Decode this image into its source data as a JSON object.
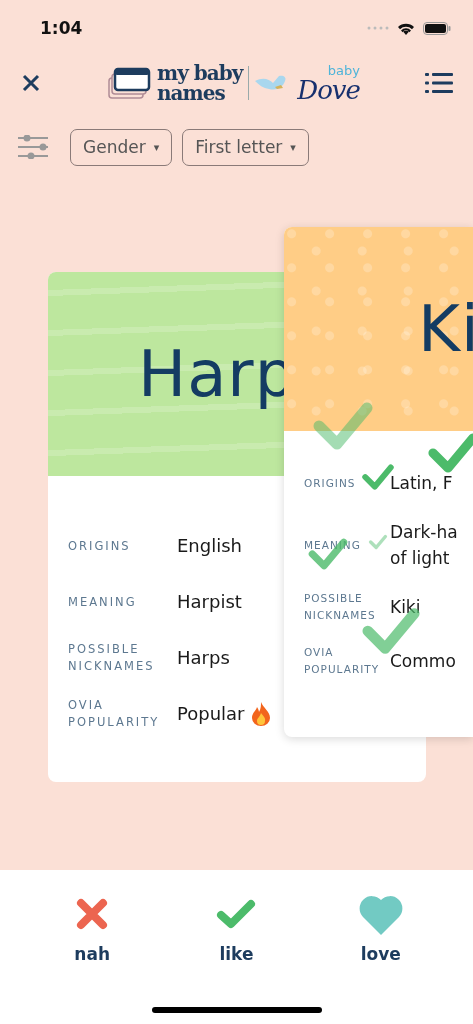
{
  "status_bar": {
    "time": "1:04"
  },
  "logo": {
    "line_1": "my baby",
    "line_2": "names",
    "partner_small": "baby",
    "partner": "Dove"
  },
  "filters": [
    {
      "label": "Gender",
      "caret": "▾"
    },
    {
      "label": "First letter",
      "caret": "▾"
    }
  ],
  "cards": [
    {
      "name": "Harp",
      "color": "#bde79e",
      "rows": [
        {
          "label": "ORIGINS",
          "value": "English",
          "hot": false
        },
        {
          "label": "MEANING",
          "value": "Harpist",
          "hot": false
        },
        {
          "label": "POSSIBLE NICKNAMES",
          "value": "Harps",
          "hot": false
        },
        {
          "label": "OVIA POPULARITY",
          "value": "Popular",
          "hot": true
        }
      ]
    },
    {
      "name": "Ki",
      "color": "#ffcd86",
      "rows": [
        {
          "label": "ORIGINS",
          "value": "Latin, F",
          "hot": false
        },
        {
          "label": "MEANING",
          "value": "Dark-ha\nof light",
          "hot": false
        },
        {
          "label": "POSSIBLE NICKNAMES",
          "value": "Kiki",
          "hot": false
        },
        {
          "label": "OVIA POPULARITY",
          "value": "Commo",
          "hot": false
        }
      ]
    }
  ],
  "actions": [
    {
      "kind": "nah",
      "label": "nah"
    },
    {
      "kind": "like",
      "label": "like"
    },
    {
      "kind": "love",
      "label": "love"
    }
  ]
}
